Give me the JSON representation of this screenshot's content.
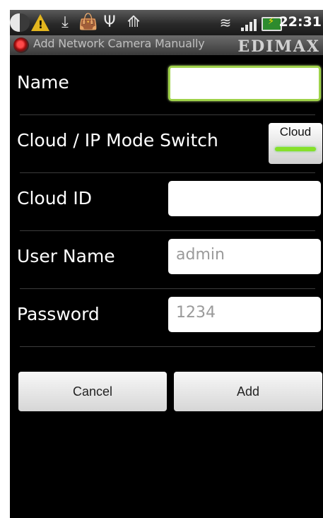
{
  "status_bar": {
    "time": "22:31",
    "icons": [
      "half-moon-icon",
      "warning-icon",
      "download-icon",
      "shopping-bag-icon",
      "usb-icon",
      "usb-tethering-icon",
      "wifi-icon",
      "signal-icon",
      "battery-charging-icon"
    ]
  },
  "title_bar": {
    "title": "Add Network Camera Manually",
    "brand": "EDIMAX"
  },
  "form": {
    "name": {
      "label": "Name",
      "value": ""
    },
    "mode_switch": {
      "label": "Cloud / IP Mode Switch",
      "value": "Cloud",
      "on": true
    },
    "cloud_id": {
      "label": "Cloud ID",
      "value": ""
    },
    "user_name": {
      "label": "User Name",
      "value": "admin"
    },
    "password": {
      "label": "Password",
      "value": "1234"
    }
  },
  "buttons": {
    "cancel": "Cancel",
    "add": "Add"
  },
  "colors": {
    "background": "#000000",
    "focus_border": "#9fd24a",
    "toggle_on": "#86e02a"
  }
}
